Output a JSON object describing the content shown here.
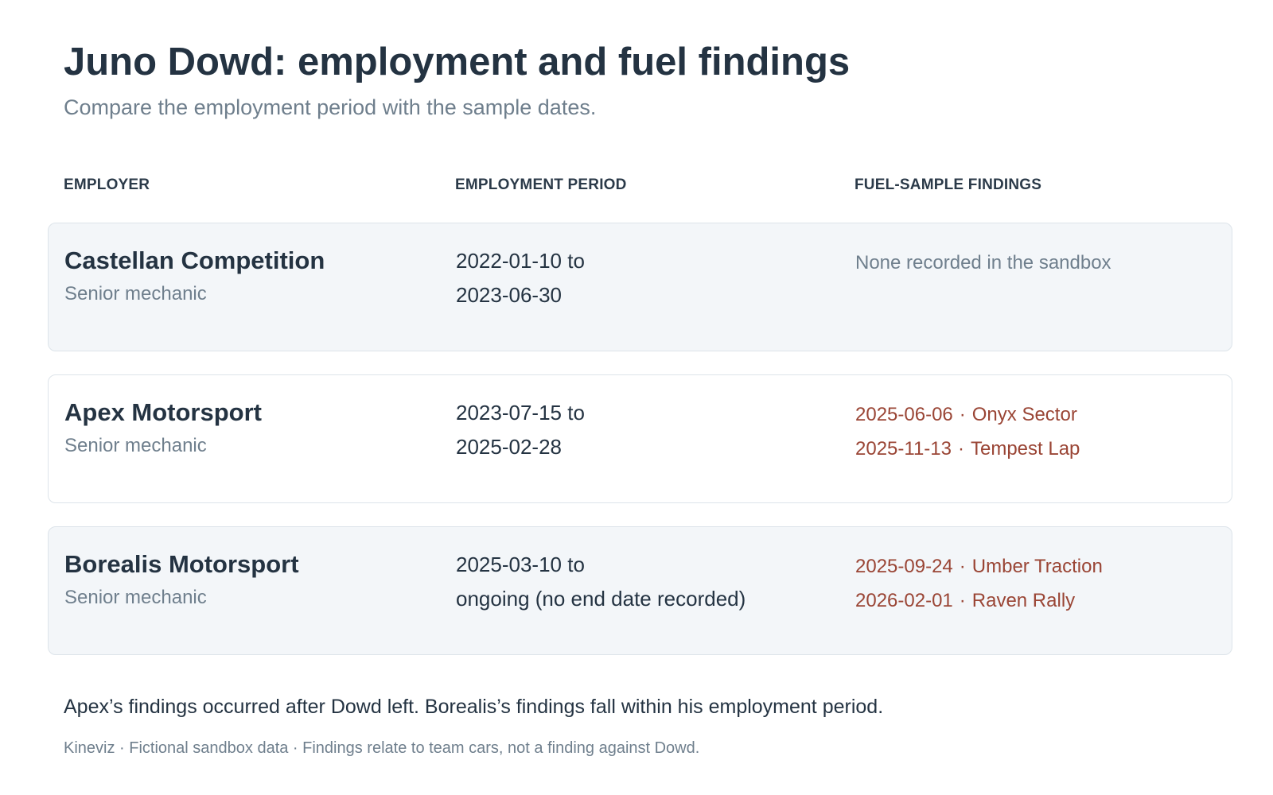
{
  "header": {
    "title": "Juno Dowd: employment and fuel findings",
    "subtitle": "Compare the employment period with the sample dates."
  },
  "columns": {
    "employer": "EMPLOYER",
    "period": "EMPLOYMENT PERIOD",
    "findings": "FUEL-SAMPLE FINDINGS"
  },
  "rows": [
    {
      "employer": "Castellan Competition",
      "role": "Senior mechanic",
      "period_start": "2022-01-10 to",
      "period_end": "2023-06-30",
      "findings_none": "None recorded in the sandbox",
      "findings": []
    },
    {
      "employer": "Apex Motorsport",
      "role": "Senior mechanic",
      "period_start": "2023-07-15 to",
      "period_end": "2025-02-28",
      "findings": [
        {
          "date": "2025-06-06",
          "event": "Onyx Sector"
        },
        {
          "date": "2025-11-13",
          "event": "Tempest Lap"
        }
      ]
    },
    {
      "employer": "Borealis Motorsport",
      "role": "Senior mechanic",
      "period_start": "2025-03-10 to",
      "period_end": "ongoing (no end date recorded)",
      "findings": [
        {
          "date": "2025-09-24",
          "event": "Umber Traction"
        },
        {
          "date": "2026-02-01",
          "event": "Raven Rally"
        }
      ]
    }
  ],
  "finding_separator": "·",
  "summary": "Apex’s findings occurred after Dowd left. Borealis’s findings fall within his employment period.",
  "footer": "Kineviz · Fictional sandbox data · Findings relate to team cars, not a finding against Dowd.",
  "colors": {
    "text": "#243342",
    "muted": "#6f7f8d",
    "finding": "#9a4535",
    "row_shaded": "#f3f6f9",
    "row_border": "#dde4ea"
  }
}
